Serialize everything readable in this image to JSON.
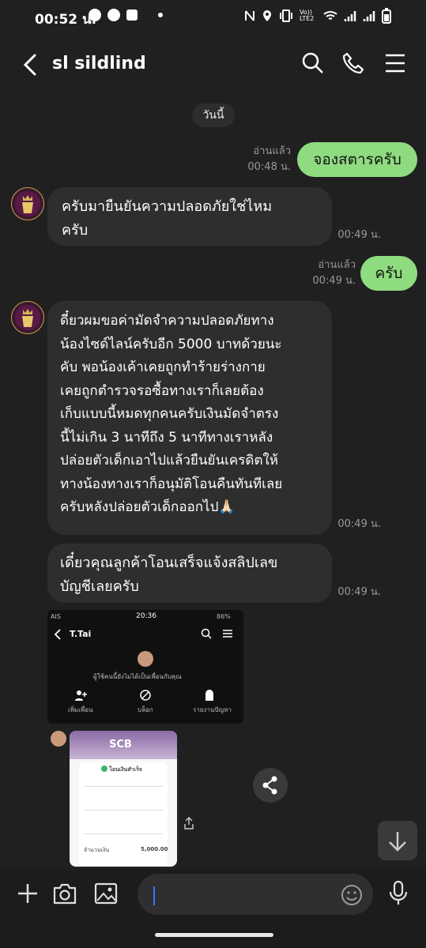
{
  "status_bar": {
    "time": "00:52 น.",
    "network_label": "Vo)) LTE2",
    "icons": [
      "messenger-icon",
      "speedometer-icon",
      "gmail-icon",
      "nfc-icon",
      "location-icon",
      "vibrate-icon",
      "wifi-icon",
      "signal-icon",
      "battery-icon"
    ]
  },
  "header": {
    "title": "sl sildlind"
  },
  "date_label": "วันนี้",
  "messages": [
    {
      "side": "right",
      "text": "จองสตารครับ",
      "read": "อ่านแล้ว",
      "time": "00:48 น."
    },
    {
      "side": "left",
      "text": "ครับมายืนยันความปลอดภัยใช่ไหม\nครับ",
      "time": "00:49 น."
    },
    {
      "side": "right",
      "text": "ครับ",
      "read": "อ่านแล้ว",
      "time": "00:49 น."
    },
    {
      "side": "left",
      "text": "ดี๋ยวผมขอค่ามัดจำความปลอดภัยทาง\nน้องไซด์ไลน์ครับอีก 5000 บาทด้วยนะ\nคับ พอน้องเค้าเคยถูกทำร้ายร่างกาย\nเคยถูกตำรวจรอซื้อทางเราก็เลยต้อง\nเก็บแบบนี้หมดทุกคนครับเงินมัดจำตรง\nนี้ไม่เกิน 3 นาทีถึง 5 นาทีทางเราหลัง\nปล่อยตัวเด็กเอาไปแล้วยืนยันเครดิตให้\nทางน้องทางเราก็อนุมัติโอนคืนทันทีเลย\nครับหลังปล่อยตัวเด็กออกไป🙏🏻",
      "time": "00:49 น."
    },
    {
      "side": "left",
      "text": "เดี๋ยวคุณลูกค้าโอนเสร็จแจ้งสลิปเลข\nบัญชีเลยครับ",
      "time": "00:49 น."
    }
  ],
  "image1": {
    "status_left": "AIS",
    "status_time": "20:36",
    "status_right": "86%",
    "contact": "T.Tai",
    "notice": "ผู้ใช้คนนี้ยังไม่ได้เป็นเพื่อนกับคุณ",
    "actions": [
      "เพิ่มเพื่อน",
      "บล็อก",
      "รายงานปัญหา"
    ]
  },
  "image2": {
    "bank": "SCB",
    "status": "โอนเงินสำเร็จ",
    "amount_label": "จำนวนเงิน",
    "amount": "5,000.00"
  }
}
